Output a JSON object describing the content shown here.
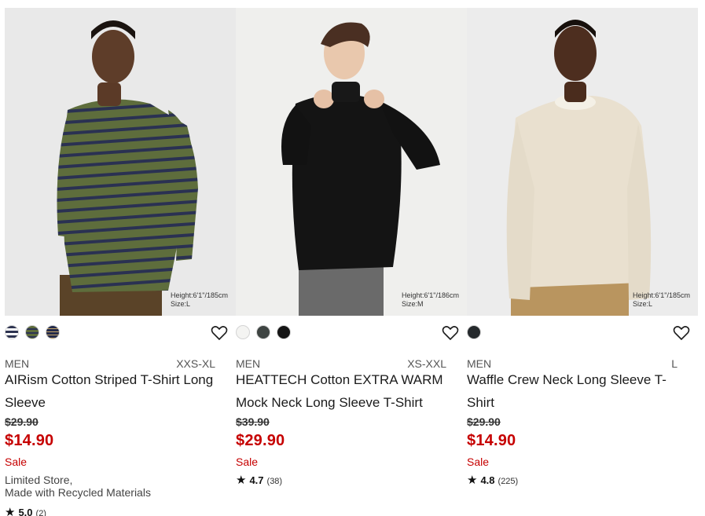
{
  "products": [
    {
      "model_note": [
        "Height:6'1\"/185cm",
        "Size:L"
      ],
      "swatches": [
        {
          "name": "navy-white-stripe-swatch",
          "color": "#2d3350",
          "stripe": "#ffffff"
        },
        {
          "name": "olive-stripe-swatch",
          "color": "#5c6b3a",
          "stripe": "#2c3352"
        },
        {
          "name": "navy-stripe-swatch",
          "color": "#232a4a",
          "stripe": "#c8a86a"
        }
      ],
      "gender": "MEN",
      "sizes": "XXS-XL",
      "title": "AIRism Cotton Striped T-Shirt Long Sleeve",
      "original_price": "$29.90",
      "price": "$14.90",
      "sale": "Sale",
      "extra": [
        "Limited Store,",
        "Made with Recycled Materials"
      ],
      "rating": {
        "star": "★",
        "score": "5.0",
        "count": "(2)"
      }
    },
    {
      "model_note": [
        "Height:6'1\"/186cm",
        "Size:M"
      ],
      "swatches": [
        {
          "name": "white-swatch",
          "color": "#f4f4f2"
        },
        {
          "name": "dark-gray-swatch",
          "color": "#3e4442"
        },
        {
          "name": "black-swatch",
          "color": "#151515"
        }
      ],
      "gender": "MEN",
      "sizes": "XS-XXL",
      "title": "HEATTECH Cotton EXTRA WARM Mock Neck Long Sleeve T-Shirt",
      "original_price": "$39.90",
      "price": "$29.90",
      "sale": "Sale",
      "rating": {
        "star": "★",
        "score": "4.7",
        "count": "(38)"
      }
    },
    {
      "model_note": [
        "Height:6'1\"/185cm",
        "Size:L"
      ],
      "swatches": [
        {
          "name": "charcoal-swatch",
          "color": "#25292c"
        }
      ],
      "gender": "MEN",
      "sizes": "L",
      "title": "Waffle Crew Neck Long Sleeve T-Shirt",
      "original_price": "$29.90",
      "price": "$14.90",
      "sale": "Sale",
      "rating": {
        "star": "★",
        "score": "4.8",
        "count": "(225)"
      }
    }
  ],
  "colors": {
    "sale_red": "#c60000",
    "text": "#1b1b1b"
  }
}
